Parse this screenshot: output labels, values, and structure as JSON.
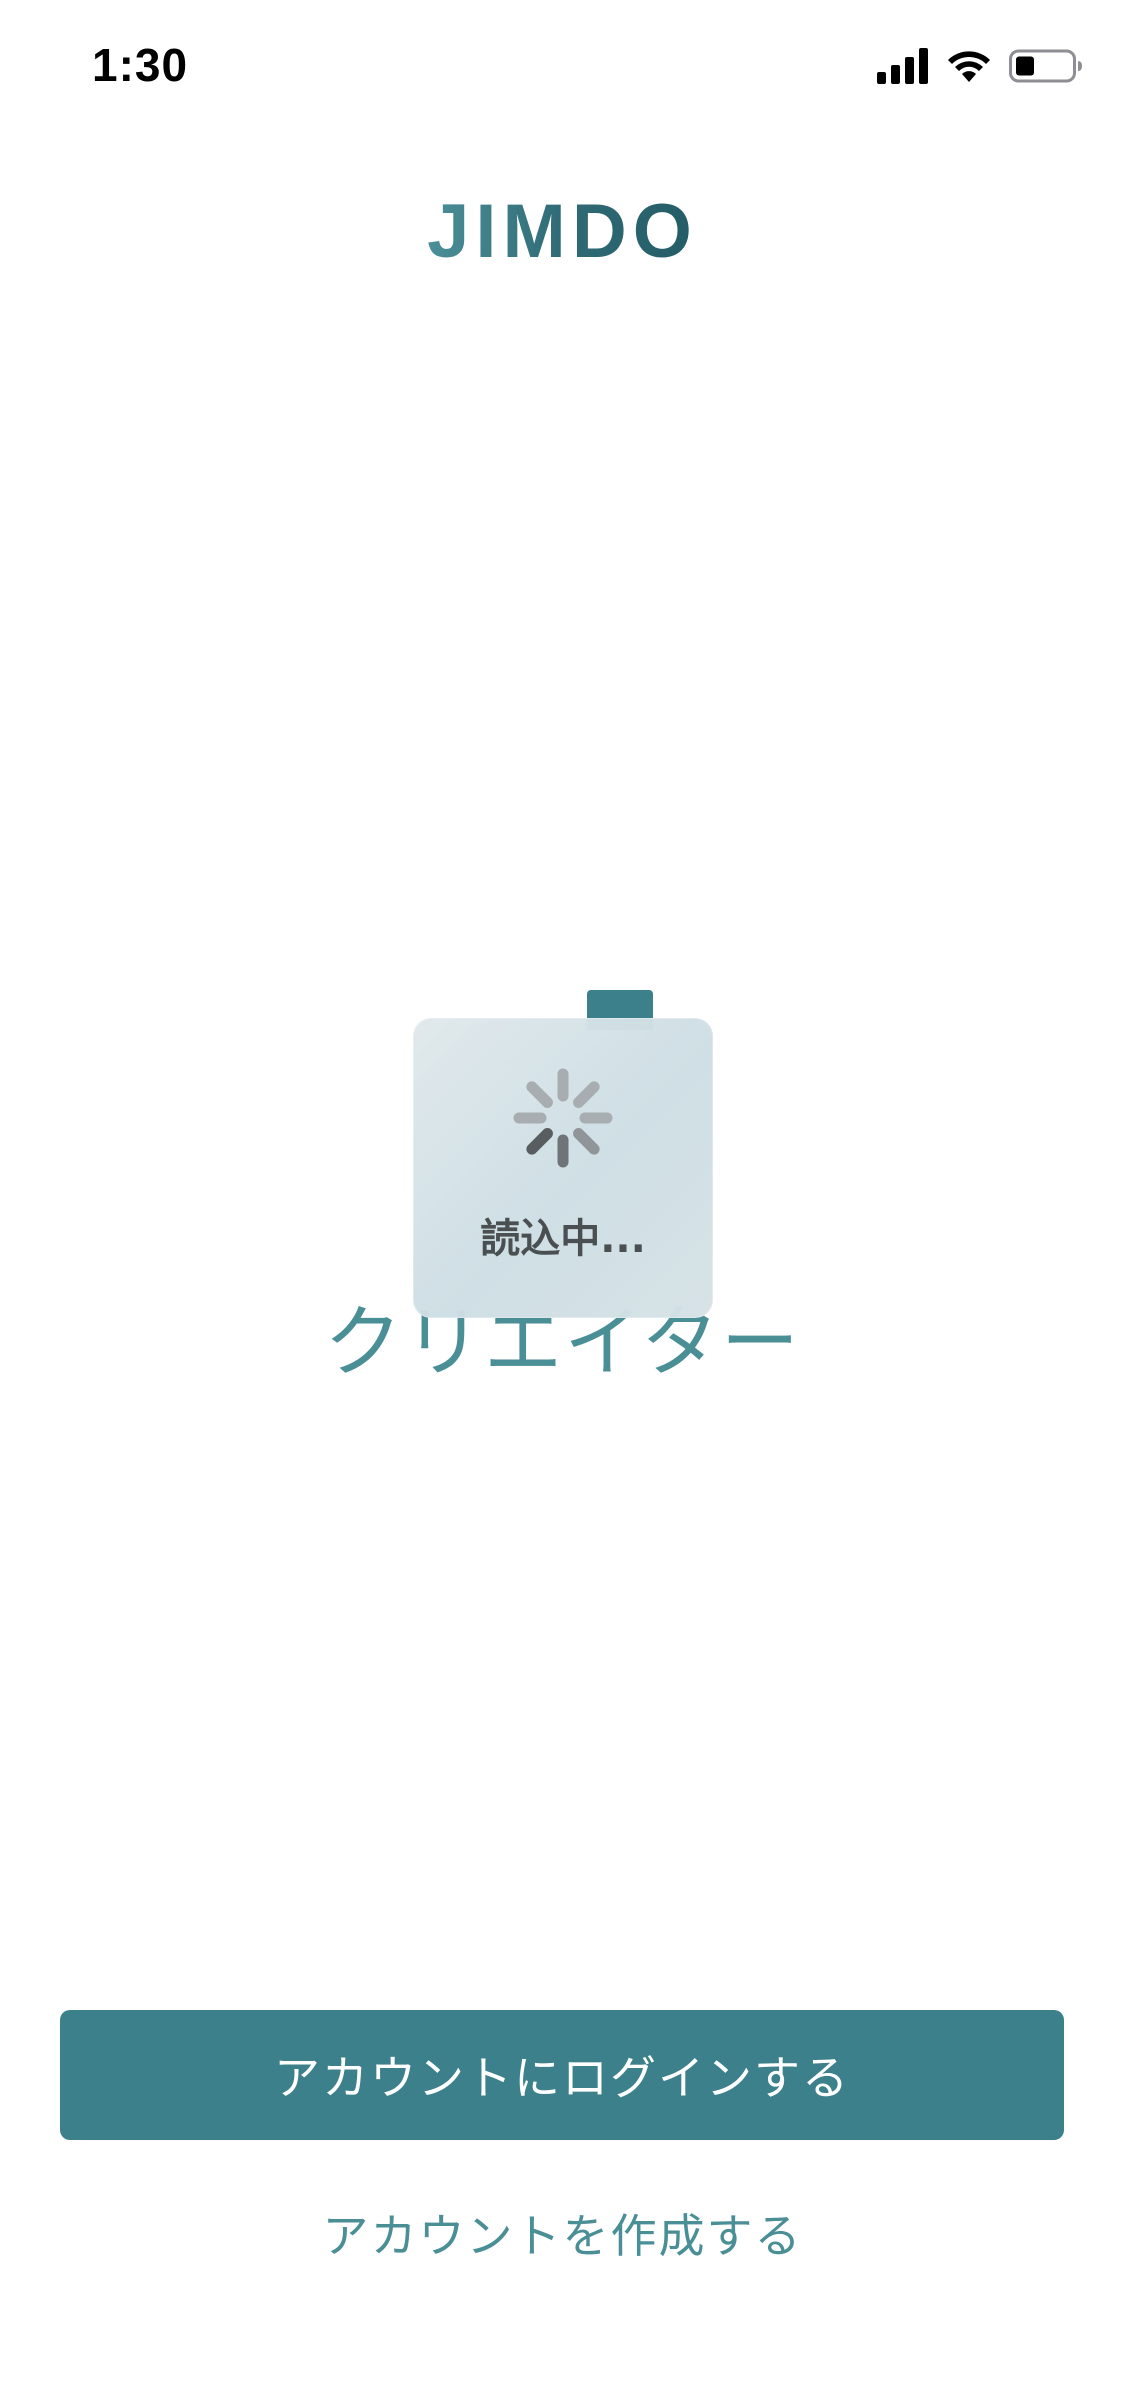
{
  "status_bar": {
    "time": "1:30",
    "icons": [
      "cellular-signal-icon",
      "wifi-icon",
      "battery-icon"
    ]
  },
  "logo": {
    "text": "JIMDO"
  },
  "hero": {
    "title": "クリエイター"
  },
  "loading": {
    "text": "読込中..."
  },
  "actions": {
    "login_label": "アカウントにログインする",
    "create_label": "アカウントを作成する"
  },
  "colors": {
    "accent": "#3b808a",
    "accent_text": "#4a8e96",
    "hud_text": "#4a4f52",
    "background": "#ffffff"
  }
}
